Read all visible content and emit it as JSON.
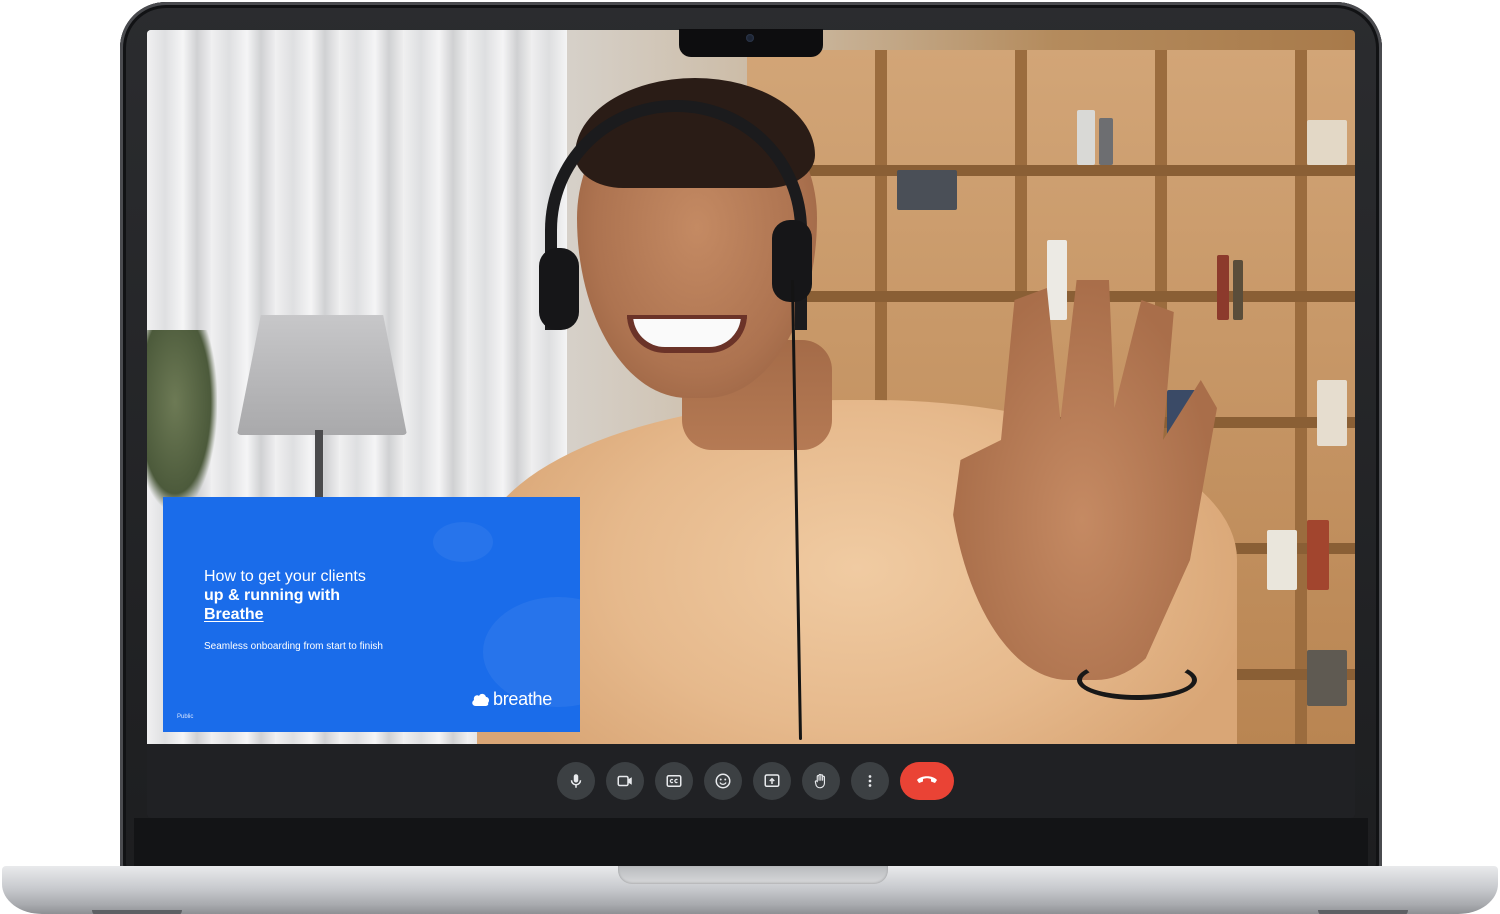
{
  "slide": {
    "title_line1": "How to get your clients",
    "title_line2": "up & running with",
    "title_line3": "Breathe",
    "subtitle": "Seamless onboarding from start to finish",
    "brand": "breathe",
    "classification": "Public",
    "background_color": "#1a6cea"
  },
  "controls": {
    "buttons": [
      {
        "name": "microphone",
        "icon": "microphone-icon"
      },
      {
        "name": "camera",
        "icon": "video-camera-icon"
      },
      {
        "name": "captions",
        "icon": "closed-captions-icon"
      },
      {
        "name": "reactions",
        "icon": "emoji-icon"
      },
      {
        "name": "present",
        "icon": "present-screen-icon"
      },
      {
        "name": "raise-hand",
        "icon": "raise-hand-icon"
      },
      {
        "name": "more-options",
        "icon": "more-vertical-icon"
      },
      {
        "name": "leave-call",
        "icon": "hang-up-icon"
      }
    ],
    "bar_color": "#202124",
    "button_color": "#3c4043",
    "end_call_color": "#ea4335"
  }
}
